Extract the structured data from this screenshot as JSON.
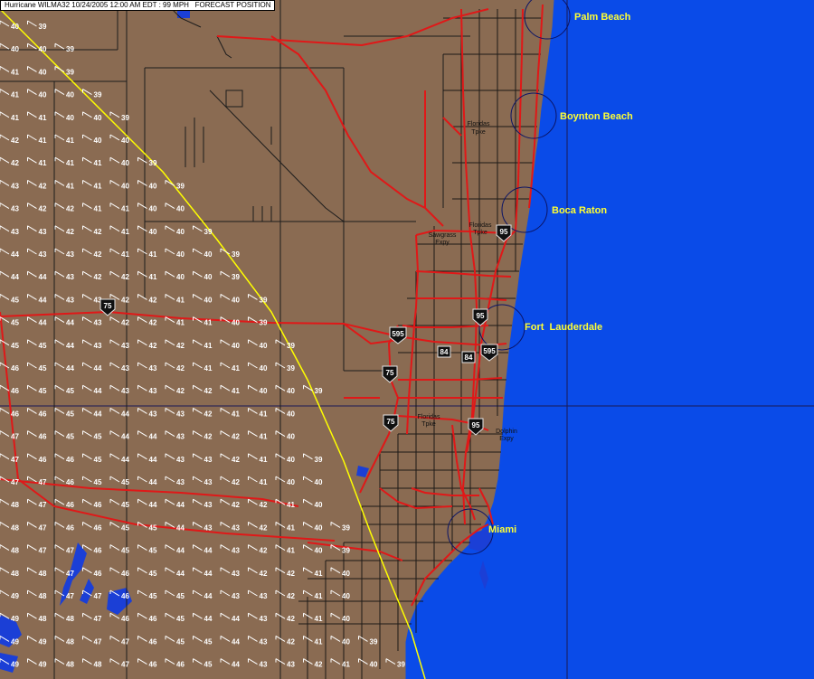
{
  "header": {
    "title": "Hurricane WILMA32 10/24/2005 12:00 AM EDT : 99 MPH   FORECAST POSITION"
  },
  "colors": {
    "ocean": "#0a4be8",
    "land": "#8a6b52",
    "road": "#e01818",
    "street": "#111111",
    "label": "#ffff33",
    "track": "#ffff00",
    "wind_barb": "#ffffff",
    "grid": "#1a1a55",
    "water": "#1b3fd6"
  },
  "cities": [
    {
      "name": "Palm Beach"
    },
    {
      "name": "Boynton Beach"
    },
    {
      "name": "Boca Raton"
    },
    {
      "name": "Fort  Lauderdale"
    },
    {
      "name": "Miami"
    }
  ],
  "shields": [
    {
      "number": "75"
    },
    {
      "number": "595"
    },
    {
      "number": "75"
    },
    {
      "number": "75"
    },
    {
      "number": "95"
    },
    {
      "number": "95"
    },
    {
      "number": "95"
    },
    {
      "number": "84"
    },
    {
      "number": "84"
    },
    {
      "number": "595"
    }
  ],
  "road_labels": [
    {
      "line1": "Floridas",
      "line2": "Tpke"
    },
    {
      "line1": "Floridas",
      "line2": "Tpke"
    },
    {
      "line1": "Sawgrass",
      "line2": "Expy"
    },
    {
      "line1": "Floridas",
      "line2": "Tpke"
    },
    {
      "line1": "Dolphin",
      "line2": "Expy"
    }
  ],
  "wind_grid_rows": [
    [
      40,
      39
    ],
    [
      40,
      40,
      39
    ],
    [
      41,
      40,
      39
    ],
    [
      41,
      40,
      40,
      39
    ],
    [
      41,
      41,
      40,
      40,
      39
    ],
    [
      42,
      41,
      41,
      40,
      40
    ],
    [
      42,
      41,
      41,
      41,
      40,
      39
    ],
    [
      43,
      42,
      41,
      41,
      40,
      40,
      39
    ],
    [
      43,
      42,
      42,
      41,
      41,
      40,
      40
    ],
    [
      43,
      43,
      42,
      42,
      41,
      40,
      40,
      39
    ],
    [
      44,
      43,
      43,
      42,
      41,
      41,
      40,
      40,
      39
    ],
    [
      44,
      44,
      43,
      42,
      42,
      41,
      40,
      40,
      39
    ],
    [
      45,
      44,
      43,
      43,
      42,
      42,
      41,
      40,
      40,
      39
    ],
    [
      45,
      44,
      44,
      43,
      42,
      42,
      41,
      41,
      40,
      39
    ],
    [
      45,
      45,
      44,
      43,
      43,
      42,
      42,
      41,
      40,
      40,
      39
    ],
    [
      46,
      45,
      44,
      44,
      43,
      43,
      42,
      41,
      41,
      40,
      39
    ],
    [
      46,
      45,
      45,
      44,
      43,
      43,
      42,
      42,
      41,
      40,
      40,
      39
    ],
    [
      46,
      46,
      45,
      44,
      44,
      43,
      43,
      42,
      41,
      41,
      40
    ],
    [
      47,
      46,
      45,
      45,
      44,
      44,
      43,
      42,
      42,
      41,
      40
    ],
    [
      47,
      46,
      46,
      45,
      44,
      44,
      43,
      43,
      42,
      41,
      40,
      39
    ],
    [
      47,
      47,
      46,
      45,
      45,
      44,
      43,
      43,
      42,
      41,
      40,
      40
    ],
    [
      48,
      47,
      46,
      46,
      45,
      44,
      44,
      43,
      42,
      42,
      41,
      40
    ],
    [
      48,
      47,
      46,
      46,
      45,
      45,
      44,
      43,
      43,
      42,
      41,
      40,
      39
    ],
    [
      48,
      47,
      47,
      46,
      45,
      45,
      44,
      44,
      43,
      42,
      41,
      40,
      39
    ],
    [
      48,
      48,
      47,
      46,
      46,
      45,
      44,
      44,
      43,
      42,
      42,
      41,
      40
    ],
    [
      49,
      48,
      47,
      47,
      46,
      45,
      45,
      44,
      43,
      43,
      42,
      41,
      40
    ],
    [
      49,
      48,
      48,
      47,
      46,
      46,
      45,
      44,
      44,
      43,
      42,
      41,
      40
    ],
    [
      49,
      49,
      48,
      47,
      47,
      46,
      45,
      45,
      44,
      43,
      42,
      41,
      40,
      39
    ],
    [
      49,
      49,
      48,
      48,
      47,
      46,
      46,
      45,
      44,
      43,
      43,
      42,
      41,
      40,
      39
    ]
  ]
}
